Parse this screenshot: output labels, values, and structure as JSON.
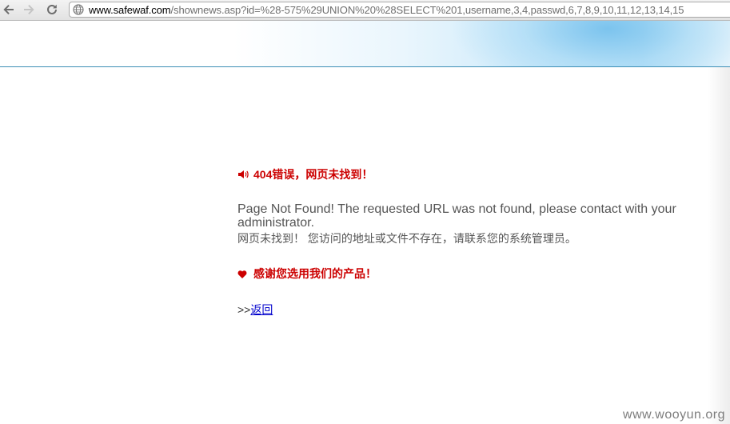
{
  "browser": {
    "url_host": "www.safewaf.com",
    "url_path": "/shownews.asp?id=%28-575%29UNION%20%28SELECT%201,username,3,4,passwd,6,7,8,9,10,11,12,13,14,15",
    "icons": {
      "back": "back-arrow-icon",
      "forward": "forward-arrow-icon",
      "reload": "reload-icon",
      "site": "globe-icon"
    }
  },
  "page": {
    "error_title": "404错误，网页未找到！",
    "message_en": "Page Not Found! The requested URL was not found, please contact with your administrator.",
    "message_cn": "网页未找到！ 您访问的地址或文件不存在，请联系您的系统管理员。",
    "thanks": "感谢您选用我们的产品！",
    "back_prefix": ">>",
    "back_link": "返回",
    "colors": {
      "accent_red": "#cc0000",
      "body_text": "#555555",
      "link": "#0000cc",
      "banner_line": "#3d8fb6"
    }
  },
  "watermark": "www.wooyun.org"
}
